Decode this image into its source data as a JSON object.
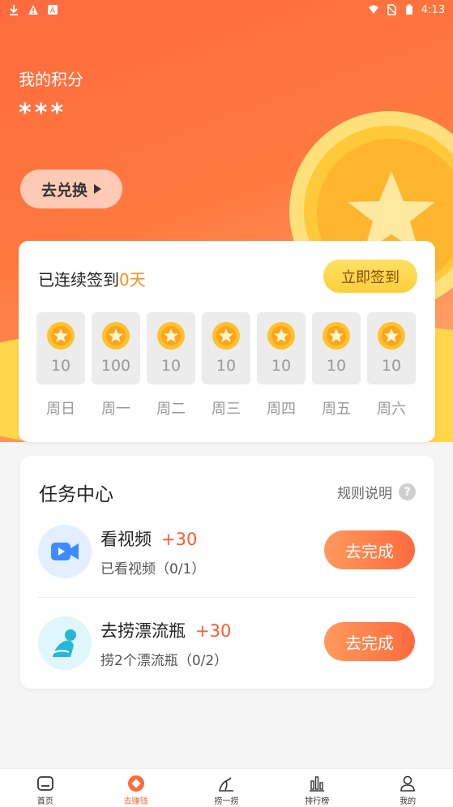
{
  "status_bar": {
    "time": "4:13"
  },
  "points": {
    "label": "我的积分",
    "value": "***",
    "exchange_label": "去兑换"
  },
  "checkin": {
    "title_prefix": "已连续签到",
    "days": "0天",
    "signin_label": "立即签到",
    "week": [
      {
        "points": "10",
        "day": "周日"
      },
      {
        "points": "100",
        "day": "周一"
      },
      {
        "points": "10",
        "day": "周二"
      },
      {
        "points": "10",
        "day": "周三"
      },
      {
        "points": "10",
        "day": "周四"
      },
      {
        "points": "10",
        "day": "周五"
      },
      {
        "points": "10",
        "day": "周六"
      }
    ]
  },
  "tasks": {
    "title": "任务中心",
    "rules_label": "规则说明",
    "help_glyph": "?",
    "items": [
      {
        "name": "看视频",
        "reward": "+30",
        "progress": "已看视频（0/1）",
        "action": "去完成",
        "icon": "video-icon"
      },
      {
        "name": "去捞漂流瓶",
        "reward": "+30",
        "progress": "捞2个漂流瓶（0/2）",
        "action": "去完成",
        "icon": "diver-icon"
      }
    ]
  },
  "tabbar": {
    "items": [
      {
        "label": "首页",
        "icon": "home-icon"
      },
      {
        "label": "去赚钱",
        "icon": "earn-icon",
        "active": true
      },
      {
        "label": "捞一捞",
        "icon": "fishing-icon"
      },
      {
        "label": "排行榜",
        "icon": "ranking-icon"
      },
      {
        "label": "我的",
        "icon": "profile-icon"
      }
    ]
  },
  "colors": {
    "accent": "#ff6a3d",
    "gold": "#ffd54a",
    "reward": "#ff5a2c"
  }
}
